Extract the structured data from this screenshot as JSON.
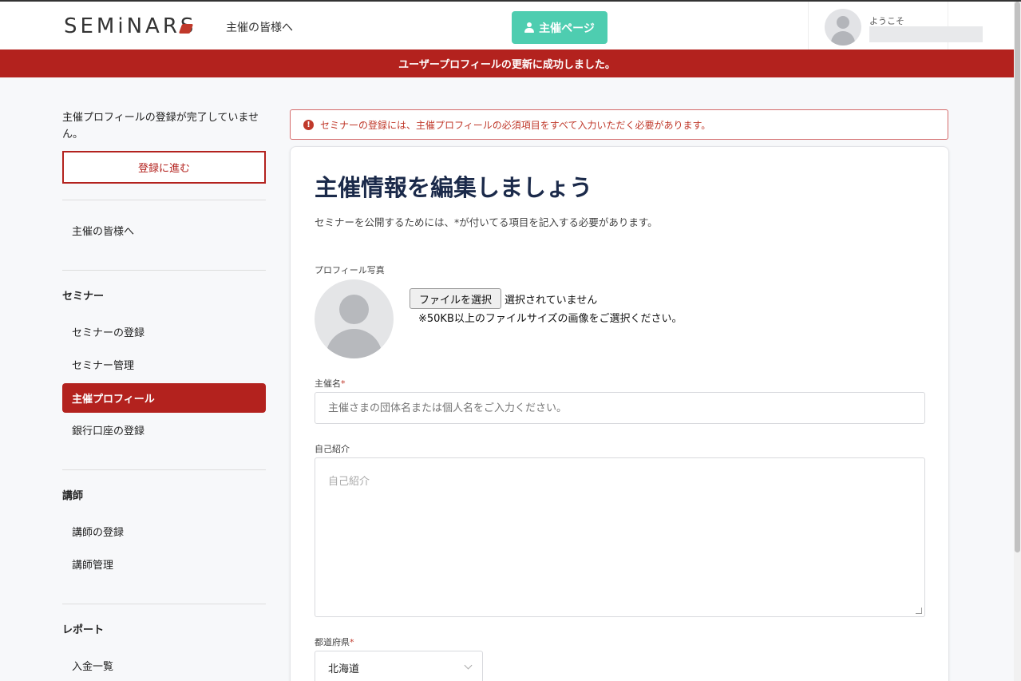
{
  "header": {
    "logo_text": "SEMiNARS",
    "nav_link": "主催の皆様へ",
    "host_button": "主催ページ",
    "welcome": "ようこそ"
  },
  "flash": {
    "success": "ユーザープロフィールの更新に成功しました。",
    "color": "#b3221e"
  },
  "sidebar": {
    "notice": "主催プロフィールの登録が完了していません。",
    "proceed_button": "登録に進む",
    "top_link": "主催の皆様へ",
    "sections": [
      {
        "heading": "セミナー",
        "items": [
          "セミナーの登録",
          "セミナー管理",
          "主催プロフィール",
          "銀行口座の登録"
        ]
      },
      {
        "heading": "講師",
        "items": [
          "講師の登録",
          "講師管理"
        ]
      },
      {
        "heading": "レポート",
        "items": [
          "入金一覧"
        ]
      }
    ],
    "active_item": "主催プロフィール"
  },
  "alert": {
    "icon": "exclamation-circle-icon",
    "text": "セミナーの登録には、主催プロフィールの必須項目をすべて入力いただく必要があります。"
  },
  "form": {
    "title": "主催情報を編集しましょう",
    "subtitle": "セミナーを公開するためには、*が付いてる項目を記入する必要があります。",
    "photo_label": "プロフィール写真",
    "file_button": "ファイルを選択",
    "file_status": "選択されていません",
    "file_note": "※50KB以上のファイルサイズの画像をご選択ください。",
    "name_label": "主催名",
    "required_mark": "*",
    "name_placeholder": "主催さまの団体名または個人名をご入力ください。",
    "bio_label": "自己紹介",
    "bio_placeholder": "自己紹介",
    "prefecture_label": "都道府県",
    "prefecture_value": "北海道"
  },
  "colors": {
    "accent_teal": "#4ecdb0",
    "brand_red": "#b3221e",
    "title_navy": "#1b2a4a"
  }
}
